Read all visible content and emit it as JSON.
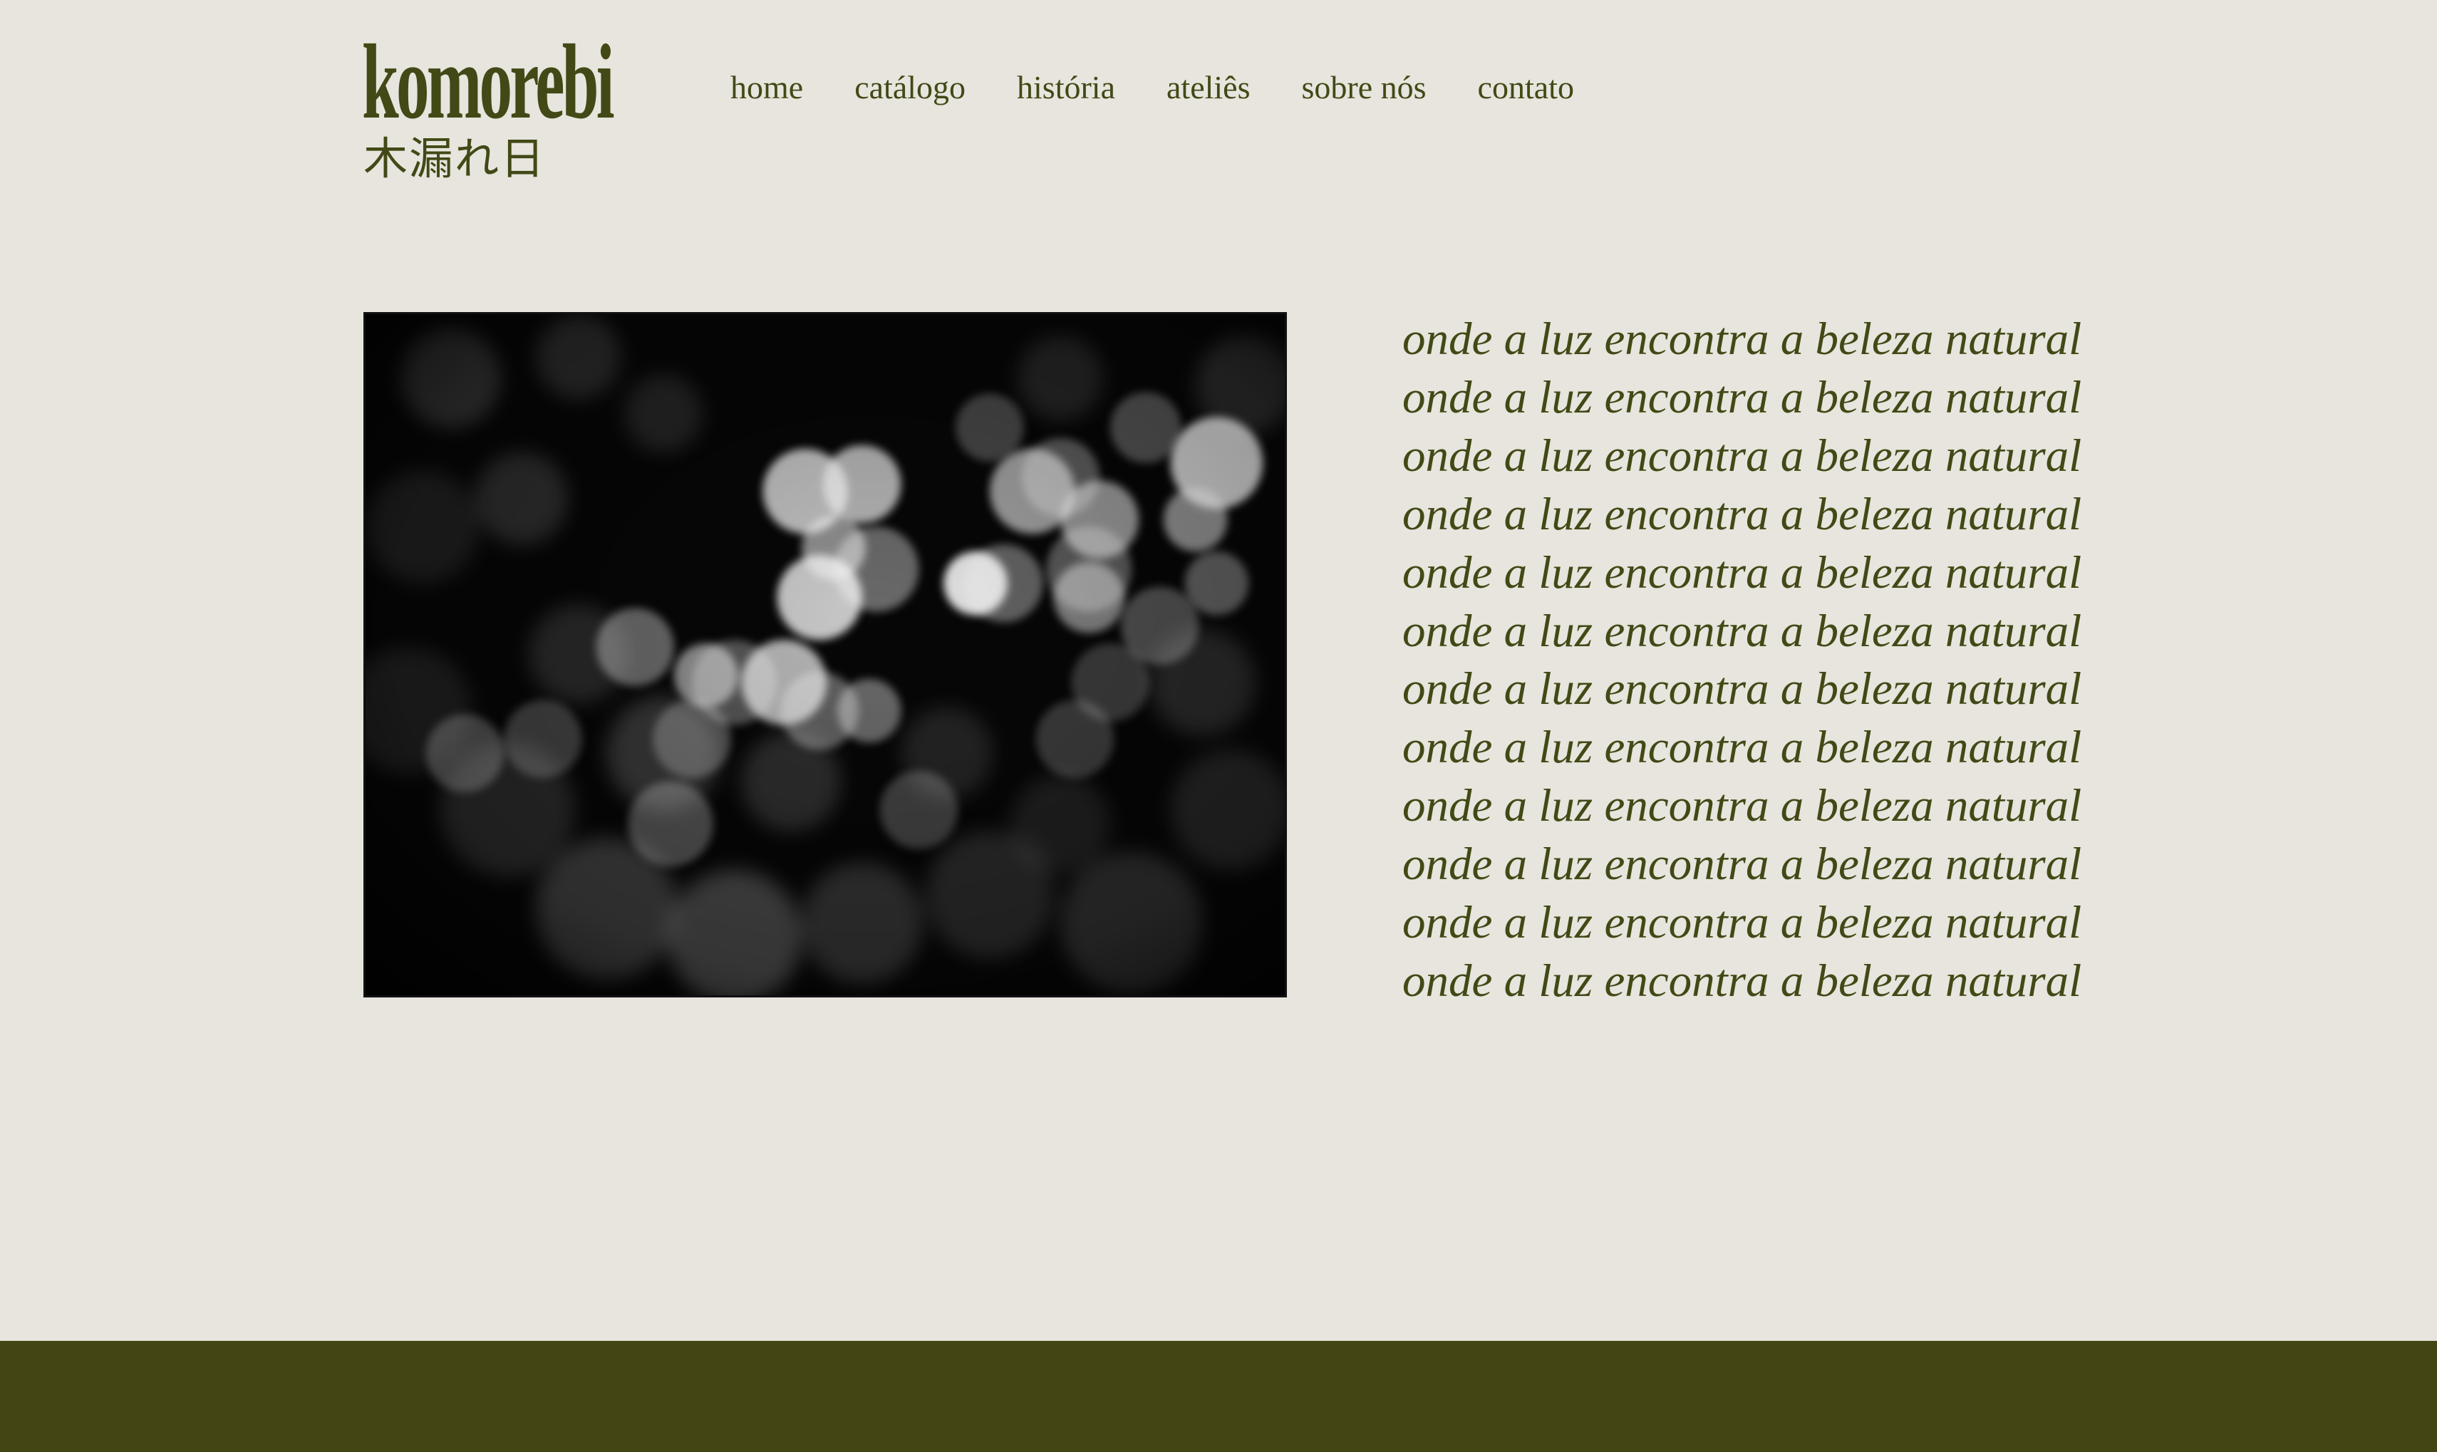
{
  "brand": {
    "name": "komorebi",
    "kanji": "木漏れ日"
  },
  "nav": {
    "items": [
      {
        "label": "home"
      },
      {
        "label": "catálogo"
      },
      {
        "label": "história"
      },
      {
        "label": "ateliês"
      },
      {
        "label": "sobre nós"
      },
      {
        "label": "contato"
      }
    ]
  },
  "hero": {
    "image_description_icon": "bokeh-leaves-photo",
    "tagline_lines": [
      "onde a luz encontra a beleza natural",
      "onde a luz encontra a beleza natural",
      "onde a luz encontra a beleza natural",
      "onde a luz encontra a beleza natural",
      "onde a luz encontra a beleza natural",
      "onde a luz encontra a beleza natural",
      "onde a luz encontra a beleza natural",
      "onde a luz encontra a beleza natural",
      "onde a luz encontra a beleza natural",
      "onde a luz encontra a beleza natural",
      "onde a luz encontra a beleza natural",
      "onde a luz encontra a beleza natural"
    ]
  },
  "colors": {
    "background": "#e7e5dd",
    "brand_green": "#424916",
    "footer": "#434514"
  }
}
